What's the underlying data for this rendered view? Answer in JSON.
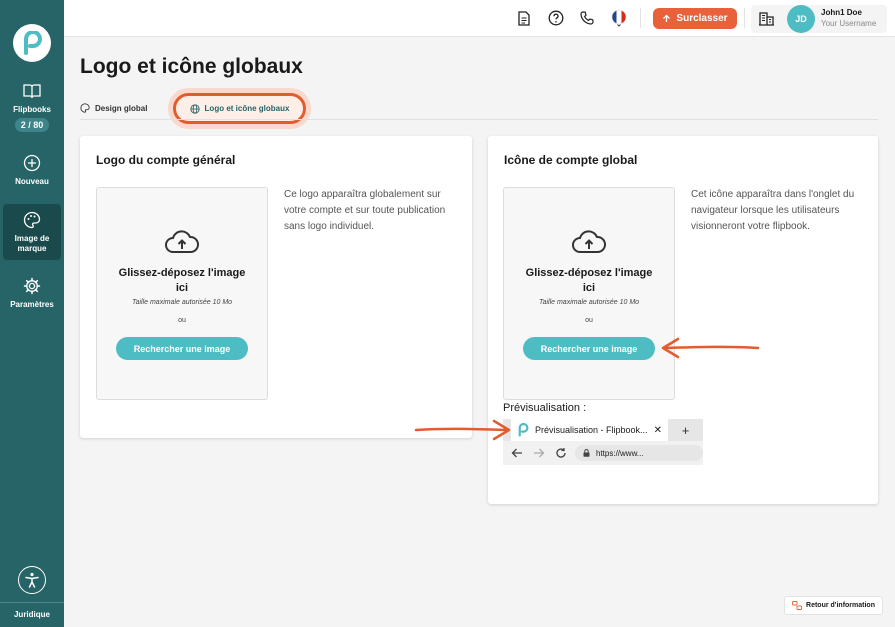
{
  "sidebar": {
    "items": [
      {
        "label": "Flipbooks",
        "counter": "2 / 80",
        "icon": "book-icon"
      },
      {
        "label": "Nouveau",
        "icon": "plus-circle-icon"
      },
      {
        "label": "Image de marque",
        "icon": "palette-icon",
        "active": true
      },
      {
        "label": "Paramètres",
        "icon": "gear-icon"
      }
    ],
    "footer_label": "Juridique"
  },
  "topbar": {
    "upgrade_label": "Surclasser",
    "avatar_initials": "JD",
    "user_name": "John1 Doe",
    "user_sub": "Your Username"
  },
  "page": {
    "title": "Logo et icône globaux",
    "tabs": [
      {
        "label": "Design global"
      },
      {
        "label": "Logo et icône globaux",
        "active": true
      }
    ]
  },
  "logo_card": {
    "title": "Logo du compte général",
    "drop_heading": "Glissez-déposez l'image ici",
    "drop_max": "Taille maximale autorisée 10 Mo",
    "drop_or": "ou",
    "drop_button": "Rechercher une image",
    "description": "Ce logo apparaîtra globalement sur votre compte et sur toute publication sans logo individuel."
  },
  "icon_card": {
    "title": "Icône de compte global",
    "drop_heading": "Glissez-déposez l'image ici",
    "drop_max": "Taille maximale autorisée 10 Mo",
    "drop_or": "ou",
    "drop_button": "Rechercher une image",
    "description": "Cet icône apparaîtra dans l'onglet du navigateur lorsque les utilisateurs visionneront votre flipbook.",
    "preview_label": "Prévisualisation :",
    "preview_tab_title": "Prévisualisation - Flipbook...",
    "preview_url": "https://www..."
  },
  "feedback_label": "Retour d'information",
  "colors": {
    "sidebar": "#266467",
    "accent": "#e8613b",
    "teal": "#4dbdc3"
  }
}
